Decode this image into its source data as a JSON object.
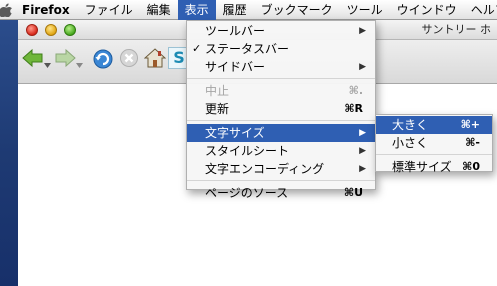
{
  "menubar": {
    "app_name": "Firefox",
    "items": [
      "ファイル",
      "編集",
      "表示",
      "履歴",
      "ブックマーク",
      "ツール",
      "ウインドウ",
      "ヘルプ"
    ],
    "active_index": 2
  },
  "window": {
    "title": "サントリー ホ"
  },
  "view_menu": {
    "items": [
      {
        "label": "ツールバー",
        "checked": false,
        "submenu": true
      },
      {
        "label": "ステータスバー",
        "checked": true,
        "submenu": false
      },
      {
        "label": "サイドバー",
        "checked": false,
        "submenu": true
      },
      {
        "label": "中止",
        "shortcut": "⌘.",
        "disabled": true
      },
      {
        "label": "更新",
        "shortcut": "⌘R",
        "disabled": false
      },
      {
        "label": "文字サイズ",
        "submenu": true,
        "highlighted": true
      },
      {
        "label": "スタイルシート",
        "submenu": true
      },
      {
        "label": "文字エンコーディング",
        "submenu": true
      },
      {
        "label": "ページのソース",
        "shortcut": "⌘U"
      }
    ]
  },
  "text_size_menu": {
    "items": [
      {
        "label": "大きく",
        "shortcut": "⌘+",
        "highlighted": true
      },
      {
        "label": "小さく",
        "shortcut": "⌘-"
      },
      {
        "label": "標準サイズ",
        "shortcut": "⌘0"
      }
    ]
  },
  "colors": {
    "menu_highlight": "#2f5fb3",
    "desktop": "#1e3a73"
  }
}
